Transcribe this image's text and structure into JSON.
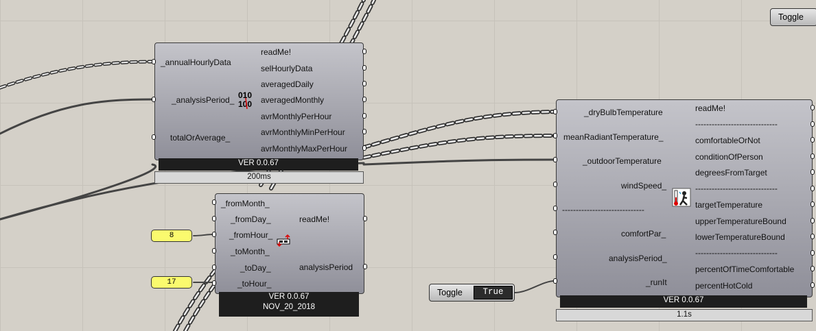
{
  "canvas": {
    "background": "#d4d0c8"
  },
  "top_toggle": {
    "label": "Toggle"
  },
  "average_component": {
    "inputs": [
      "_annualHourlyData",
      "_analysisPeriod_",
      "totalOrAverage_"
    ],
    "outputs": [
      "readMe!",
      "selHourlyData",
      "averagedDaily",
      "averagedMonthly",
      "avrMonthlyPerHour",
      "avrMonthlyMinPerHour",
      "avrMonthlyMaxPerHour"
    ],
    "icon": "binary-data-icon",
    "version": "VER 0.0.67",
    "profiler": "200ms"
  },
  "analysis_period_component": {
    "inputs": [
      "_fromMonth_",
      "_fromDay_",
      "_fromHour_",
      "_toMonth_",
      "_toDay_",
      "_toHour_"
    ],
    "outputs": [
      "readMe!",
      "analysisPeriod"
    ],
    "icon": "period-arrows-icon",
    "version": "VER 0.0.67",
    "date": "NOV_20_2018"
  },
  "panel_from_hour": {
    "value": "8"
  },
  "panel_to_hour": {
    "value": "17"
  },
  "run_toggle": {
    "label": "Toggle",
    "value": "True"
  },
  "comfort_component": {
    "inputs": [
      "_dryBulbTemperature",
      "meanRadiantTemperature_",
      "_outdoorTemperature",
      "windSpeed_",
      "------------------------------",
      "comfortPar_",
      "analysisPeriod_",
      "_runIt"
    ],
    "outputs": [
      "readMe!",
      "------------------------------",
      "comfortableOrNot",
      "conditionOfPerson",
      "degreesFromTarget",
      "------------------------------",
      "targetTemperature",
      "upperTemperatureBound",
      "lowerTemperatureBound",
      "------------------------------",
      "percentOfTimeComfortable",
      "percentHotCold"
    ],
    "icon": "person-thermometer-icon",
    "version": "VER 0.0.67",
    "profiler": "1.1s"
  }
}
